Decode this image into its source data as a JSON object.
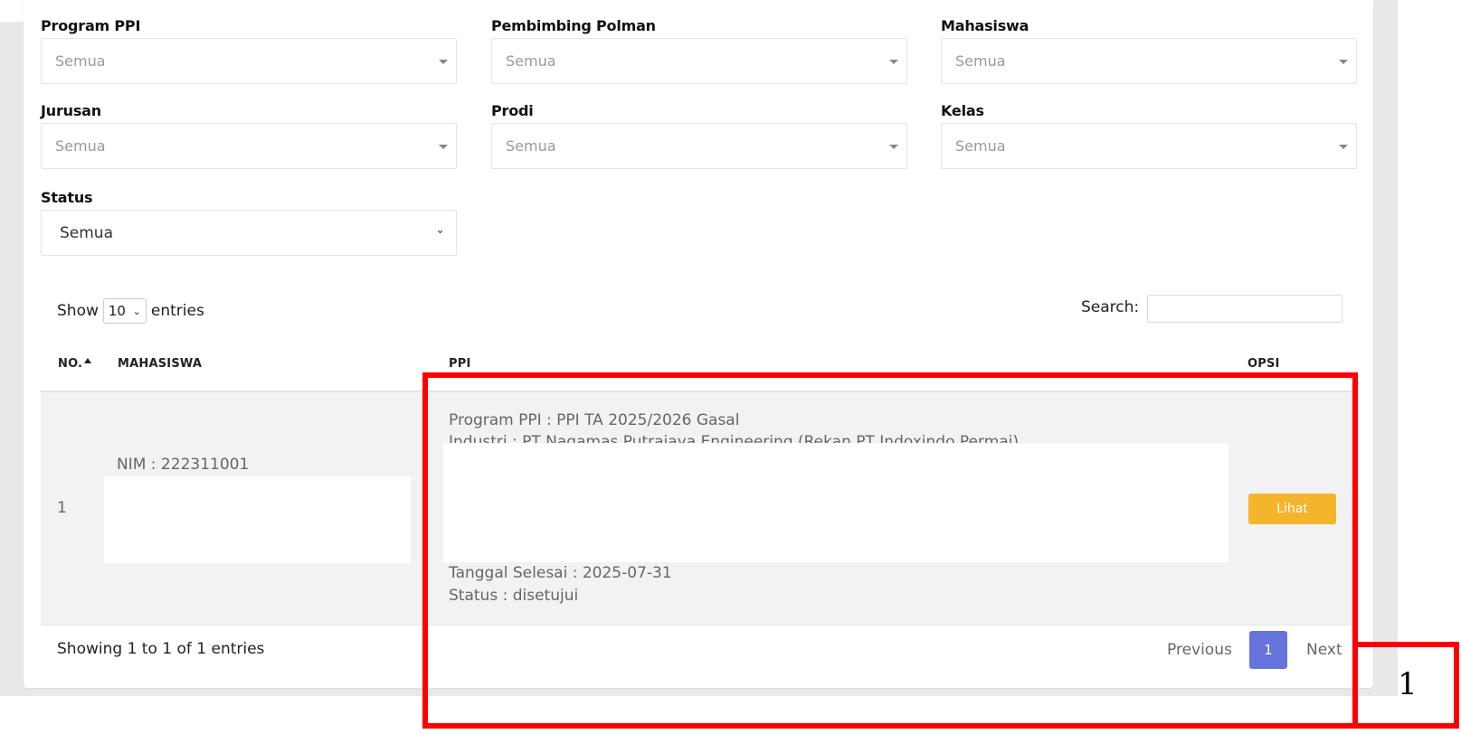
{
  "filters": {
    "program_ppi": {
      "label": "Program PPI",
      "value": "Semua"
    },
    "pembimbing_polman": {
      "label": "Pembimbing Polman",
      "value": "Semua"
    },
    "mahasiswa": {
      "label": "Mahasiswa",
      "value": "Semua"
    },
    "jurusan": {
      "label": "Jurusan",
      "value": "Semua"
    },
    "prodi": {
      "label": "Prodi",
      "value": "Semua"
    },
    "kelas": {
      "label": "Kelas",
      "value": "Semua"
    },
    "status": {
      "label": "Status",
      "value": "Semua"
    }
  },
  "table_controls": {
    "show_label": "Show",
    "entries_value": "10",
    "entries_label": "entries",
    "search_label": "Search:",
    "search_value": ""
  },
  "table": {
    "headers": {
      "no": "NO.",
      "mahasiswa": "MAHASISWA",
      "ppi": "PPI",
      "opsi": "OPSI"
    },
    "rows": [
      {
        "no": "1",
        "nim": "NIM : 222311001",
        "program_ppi": "Program PPI : PPI TA 2025/2026 Gasal",
        "industri": "Industri : PT Nagamas Putrajaya Engineering (Rekan PT Indoxindo Permai)",
        "tanggal_selesai": "Tanggal Selesai : 2025-07-31",
        "status": "Status : disetujui",
        "action_label": "Lihat"
      }
    ]
  },
  "footer": {
    "info": "Showing 1 to 1 of 1 entries",
    "previous": "Previous",
    "current_page": "1",
    "next": "Next"
  },
  "annotation": {
    "label": "1",
    "color": "#ff0000"
  },
  "colors": {
    "action_button": "#f4b42c",
    "active_page": "#6673da",
    "highlight": "#ff0000"
  }
}
